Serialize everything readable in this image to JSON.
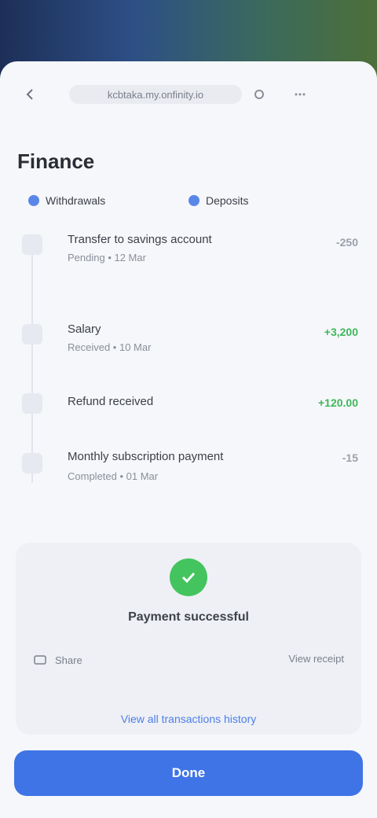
{
  "header": {
    "url": "kcbtaka.my.onfinity.io"
  },
  "page": {
    "title": "Finance"
  },
  "tabs": [
    {
      "label": "Withdrawals"
    },
    {
      "label": "Deposits"
    }
  ],
  "transactions": [
    {
      "title": "Transfer to savings account",
      "subtitle": "Pending • 12 Mar",
      "detail": "",
      "amount": "-250",
      "status": "neutral"
    },
    {
      "title": "Salary",
      "subtitle": "Received • 10 Mar",
      "detail": "",
      "amount": "+3,200",
      "status": "positive"
    },
    {
      "title": "Refund received",
      "subtitle": "",
      "detail": "",
      "amount": "+120.00",
      "status": "positive"
    },
    {
      "title": "Monthly subscription payment",
      "subtitle": "Completed • 01 Mar",
      "detail": "",
      "amount": "-15",
      "status": "neutral"
    }
  ],
  "summary_card": {
    "message": "Payment successful",
    "left_label": "Share",
    "right_label": "View receipt"
  },
  "link": {
    "label": "View all transactions history"
  },
  "primary_button": {
    "label": "Done"
  },
  "colors": {
    "accent": "#3f74e6",
    "success": "#44c45e",
    "background": "#f6f7fa"
  }
}
